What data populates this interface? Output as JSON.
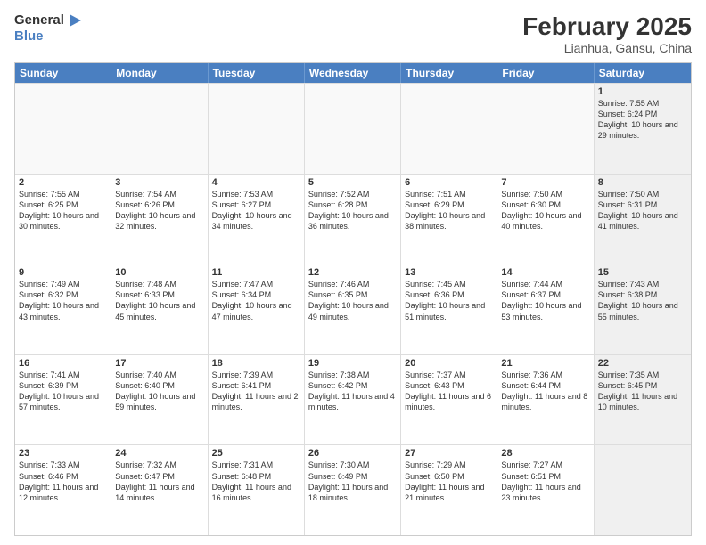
{
  "header": {
    "logo_line1": "General",
    "logo_line2": "Blue",
    "month_year": "February 2025",
    "location": "Lianhua, Gansu, China"
  },
  "weekdays": [
    "Sunday",
    "Monday",
    "Tuesday",
    "Wednesday",
    "Thursday",
    "Friday",
    "Saturday"
  ],
  "weeks": [
    [
      {
        "day": "",
        "text": "",
        "empty": true
      },
      {
        "day": "",
        "text": "",
        "empty": true
      },
      {
        "day": "",
        "text": "",
        "empty": true
      },
      {
        "day": "",
        "text": "",
        "empty": true
      },
      {
        "day": "",
        "text": "",
        "empty": true
      },
      {
        "day": "",
        "text": "",
        "empty": true
      },
      {
        "day": "1",
        "text": "Sunrise: 7:55 AM\nSunset: 6:24 PM\nDaylight: 10 hours and 29 minutes.",
        "shaded": true
      }
    ],
    [
      {
        "day": "2",
        "text": "Sunrise: 7:55 AM\nSunset: 6:25 PM\nDaylight: 10 hours and 30 minutes."
      },
      {
        "day": "3",
        "text": "Sunrise: 7:54 AM\nSunset: 6:26 PM\nDaylight: 10 hours and 32 minutes."
      },
      {
        "day": "4",
        "text": "Sunrise: 7:53 AM\nSunset: 6:27 PM\nDaylight: 10 hours and 34 minutes."
      },
      {
        "day": "5",
        "text": "Sunrise: 7:52 AM\nSunset: 6:28 PM\nDaylight: 10 hours and 36 minutes."
      },
      {
        "day": "6",
        "text": "Sunrise: 7:51 AM\nSunset: 6:29 PM\nDaylight: 10 hours and 38 minutes."
      },
      {
        "day": "7",
        "text": "Sunrise: 7:50 AM\nSunset: 6:30 PM\nDaylight: 10 hours and 40 minutes."
      },
      {
        "day": "8",
        "text": "Sunrise: 7:50 AM\nSunset: 6:31 PM\nDaylight: 10 hours and 41 minutes.",
        "shaded": true
      }
    ],
    [
      {
        "day": "9",
        "text": "Sunrise: 7:49 AM\nSunset: 6:32 PM\nDaylight: 10 hours and 43 minutes."
      },
      {
        "day": "10",
        "text": "Sunrise: 7:48 AM\nSunset: 6:33 PM\nDaylight: 10 hours and 45 minutes."
      },
      {
        "day": "11",
        "text": "Sunrise: 7:47 AM\nSunset: 6:34 PM\nDaylight: 10 hours and 47 minutes."
      },
      {
        "day": "12",
        "text": "Sunrise: 7:46 AM\nSunset: 6:35 PM\nDaylight: 10 hours and 49 minutes."
      },
      {
        "day": "13",
        "text": "Sunrise: 7:45 AM\nSunset: 6:36 PM\nDaylight: 10 hours and 51 minutes."
      },
      {
        "day": "14",
        "text": "Sunrise: 7:44 AM\nSunset: 6:37 PM\nDaylight: 10 hours and 53 minutes."
      },
      {
        "day": "15",
        "text": "Sunrise: 7:43 AM\nSunset: 6:38 PM\nDaylight: 10 hours and 55 minutes.",
        "shaded": true
      }
    ],
    [
      {
        "day": "16",
        "text": "Sunrise: 7:41 AM\nSunset: 6:39 PM\nDaylight: 10 hours and 57 minutes."
      },
      {
        "day": "17",
        "text": "Sunrise: 7:40 AM\nSunset: 6:40 PM\nDaylight: 10 hours and 59 minutes."
      },
      {
        "day": "18",
        "text": "Sunrise: 7:39 AM\nSunset: 6:41 PM\nDaylight: 11 hours and 2 minutes."
      },
      {
        "day": "19",
        "text": "Sunrise: 7:38 AM\nSunset: 6:42 PM\nDaylight: 11 hours and 4 minutes."
      },
      {
        "day": "20",
        "text": "Sunrise: 7:37 AM\nSunset: 6:43 PM\nDaylight: 11 hours and 6 minutes."
      },
      {
        "day": "21",
        "text": "Sunrise: 7:36 AM\nSunset: 6:44 PM\nDaylight: 11 hours and 8 minutes."
      },
      {
        "day": "22",
        "text": "Sunrise: 7:35 AM\nSunset: 6:45 PM\nDaylight: 11 hours and 10 minutes.",
        "shaded": true
      }
    ],
    [
      {
        "day": "23",
        "text": "Sunrise: 7:33 AM\nSunset: 6:46 PM\nDaylight: 11 hours and 12 minutes."
      },
      {
        "day": "24",
        "text": "Sunrise: 7:32 AM\nSunset: 6:47 PM\nDaylight: 11 hours and 14 minutes."
      },
      {
        "day": "25",
        "text": "Sunrise: 7:31 AM\nSunset: 6:48 PM\nDaylight: 11 hours and 16 minutes."
      },
      {
        "day": "26",
        "text": "Sunrise: 7:30 AM\nSunset: 6:49 PM\nDaylight: 11 hours and 18 minutes."
      },
      {
        "day": "27",
        "text": "Sunrise: 7:29 AM\nSunset: 6:50 PM\nDaylight: 11 hours and 21 minutes."
      },
      {
        "day": "28",
        "text": "Sunrise: 7:27 AM\nSunset: 6:51 PM\nDaylight: 11 hours and 23 minutes."
      },
      {
        "day": "",
        "text": "",
        "empty": true,
        "shaded": true
      }
    ]
  ]
}
